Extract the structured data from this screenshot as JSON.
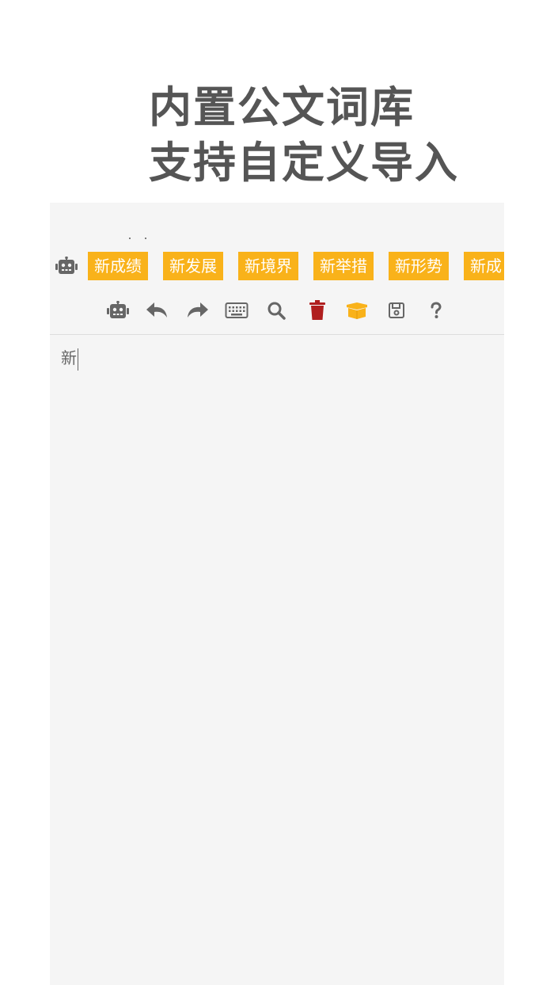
{
  "promo": {
    "line1": "内置公文词库",
    "line2": "支持自定义导入"
  },
  "suggestions": {
    "chips": [
      "新成绩",
      "新发展",
      "新境界",
      "新举措",
      "新形势",
      "新成"
    ]
  },
  "toolbar": {
    "icons": [
      "robot-icon",
      "undo-icon",
      "redo-icon",
      "keyboard-icon",
      "search-icon",
      "trash-icon",
      "box-icon",
      "save-icon",
      "help-icon"
    ]
  },
  "editor": {
    "text": "新"
  },
  "colors": {
    "chip": "#f9b21a",
    "trash": "#b01e1e",
    "box": "#f9b21a",
    "icon": "#666666",
    "headline": "#555555"
  }
}
